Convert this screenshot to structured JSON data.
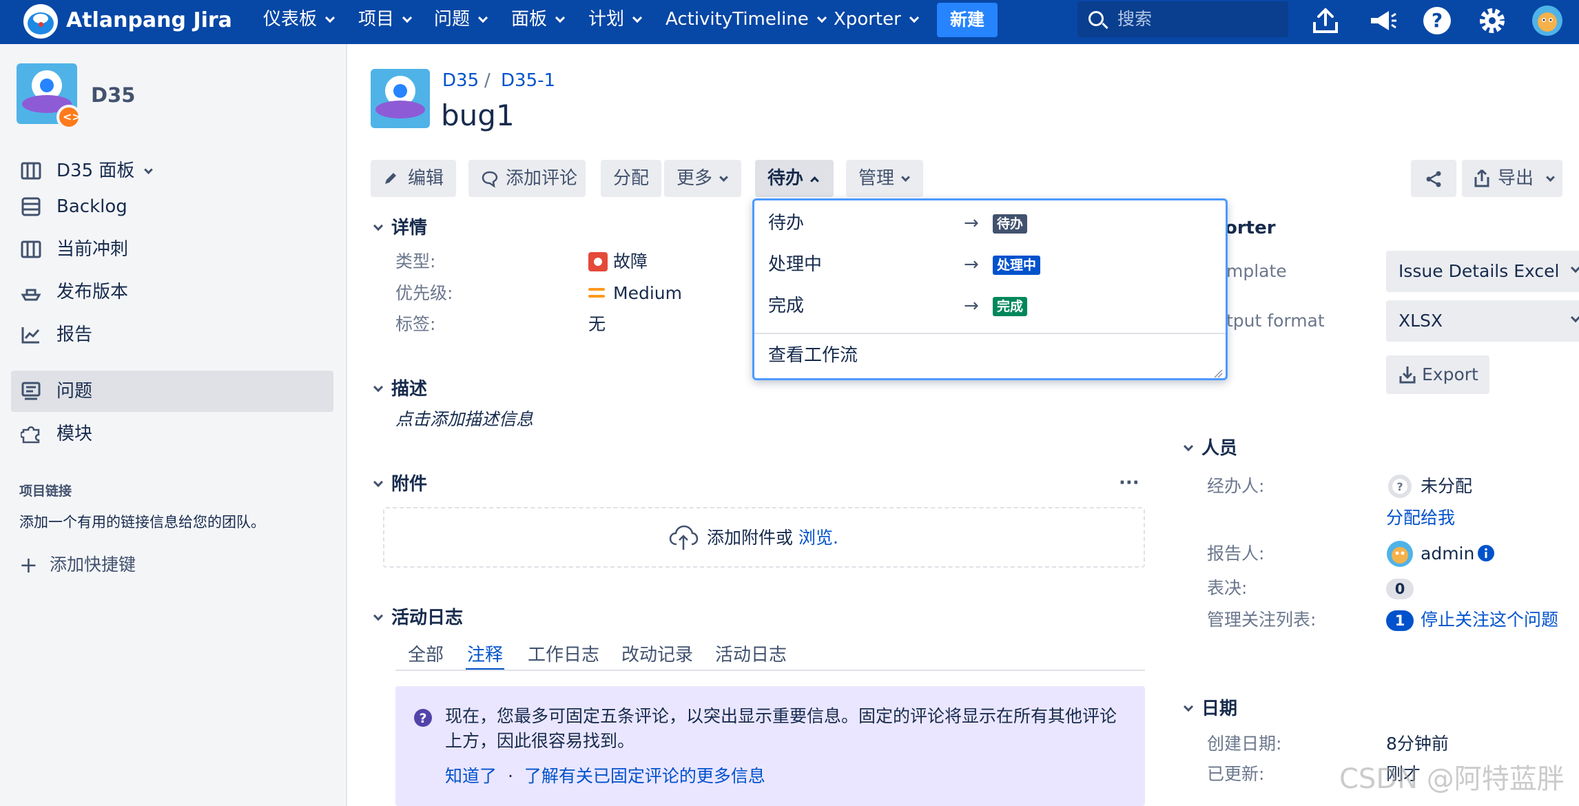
{
  "topnav": {
    "brand": "Atlanpang Jira",
    "items": [
      "仪表板",
      "项目",
      "问题",
      "面板",
      "计划",
      "ActivityTimeline",
      "Xporter"
    ],
    "create_label": "新建",
    "search_placeholder": "搜索"
  },
  "sidebar": {
    "project_name": "D35",
    "items": [
      {
        "label": "D35 面板",
        "icon": "board-icon"
      },
      {
        "label": "Backlog",
        "icon": "backlog-icon"
      },
      {
        "label": "当前冲刺",
        "icon": "sprint-icon"
      },
      {
        "label": "发布版本",
        "icon": "ship-icon"
      },
      {
        "label": "报告",
        "icon": "chart-icon"
      },
      {
        "label": "问题",
        "icon": "issues-icon"
      },
      {
        "label": "模块",
        "icon": "puzzle-icon"
      }
    ],
    "project_links_title": "项目链接",
    "project_links_desc": "添加一个有用的链接信息给您的团队。",
    "add_shortcut": "添加快捷键"
  },
  "issue": {
    "breadcrumb_project": "D35",
    "breadcrumb_sep": "/",
    "breadcrumb_key": "D35-1",
    "title": "bug1"
  },
  "toolbar": {
    "edit": "编辑",
    "comment": "添加评论",
    "assign": "分配",
    "more": "更多",
    "status": "待办",
    "admin": "管理",
    "export": "导出"
  },
  "details": {
    "heading": "详情",
    "type_label": "类型:",
    "type_value": "故障",
    "priority_label": "优先级:",
    "priority_value": "Medium",
    "labels_label": "标签:",
    "labels_value": "无"
  },
  "description": {
    "heading": "描述",
    "placeholder": "点击添加描述信息"
  },
  "attachments": {
    "heading": "附件",
    "more": "···",
    "drop_text": "添加附件或 ",
    "browse": "浏览."
  },
  "activity": {
    "heading": "活动日志",
    "tabs": [
      "全部",
      "注释",
      "工作日志",
      "改动记录",
      "活动日志"
    ],
    "info_text_1": "现在，您最多可固定五条评论，以突出显示重要信息。固定的评论将显示在所有其他评论",
    "info_text_2": "上方，因此很容易找到。",
    "got_it": "知道了",
    "dot": "·",
    "learn_more": "了解有关已固定评论的更多信息"
  },
  "status_dropdown": {
    "transitions": [
      {
        "label": "待办",
        "arrow": "→",
        "target": "待办",
        "color": "#42526e"
      },
      {
        "label": "处理中",
        "arrow": "→",
        "target": "处理中",
        "color": "#0052cc"
      },
      {
        "label": "完成",
        "arrow": "→",
        "target": "完成",
        "color": "#00875a"
      }
    ],
    "view_workflow": "查看工作流"
  },
  "xporter": {
    "heading_partial": "orter",
    "template_label": "mplate",
    "template_value": "Issue Details Excel",
    "format_label": "tput format",
    "format_value": "XLSX",
    "export_button": "Export"
  },
  "people": {
    "heading": "人员",
    "assignee_label": "经办人:",
    "assignee_value": "未分配",
    "assign_to_me": "分配给我",
    "reporter_label": "报告人:",
    "reporter_value": "admin",
    "votes_label": "表决:",
    "votes_value": "0",
    "watchers_label": "管理关注列表:",
    "watchers_count": "1",
    "stop_watching": "停止关注这个问题"
  },
  "dates": {
    "heading": "日期",
    "created_label": "创建日期:",
    "created_value": "8分钟前",
    "updated_label": "已更新:",
    "updated_value": "刚才"
  },
  "watermark": "CSDN @阿特蓝胖",
  "colors": {
    "nav_bg": "#0747a6",
    "create_bg": "#2684ff",
    "link": "#0052cc",
    "bug_red": "#e5493a",
    "priority_orange": "#ff991f",
    "info_bg": "#eae6ff"
  }
}
